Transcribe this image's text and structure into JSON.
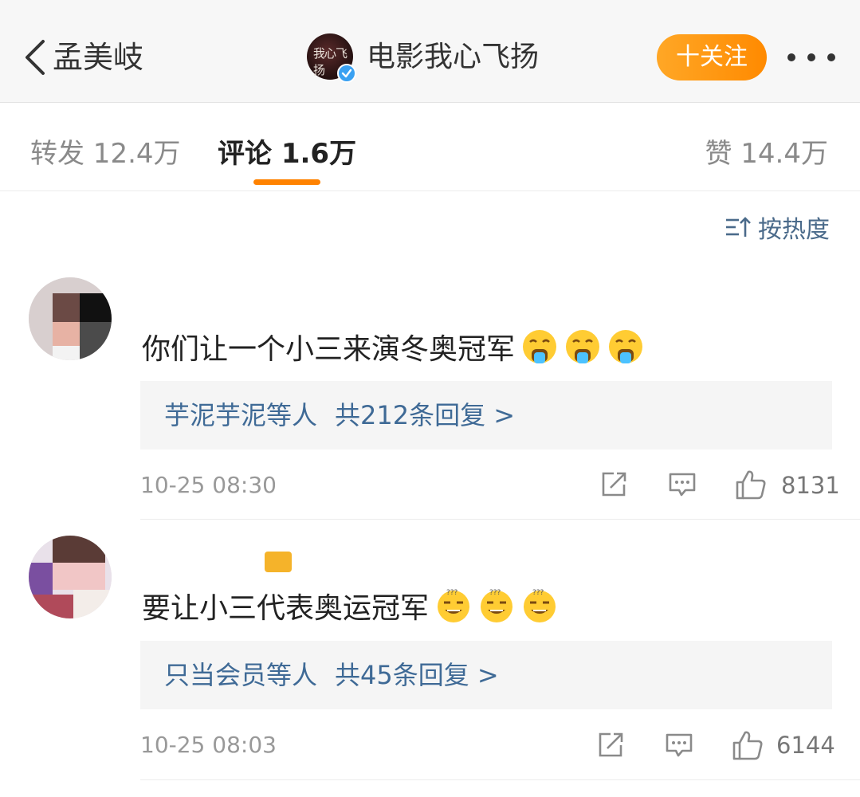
{
  "header": {
    "back_label": "孟美岐",
    "account_name": "电影我心飞扬",
    "follow_label": "十关注"
  },
  "tabs": {
    "repost": "转发 12.4万",
    "comments": "评论 1.6万",
    "likes": "赞 14.4万"
  },
  "sort": {
    "label": "按热度"
  },
  "comments": [
    {
      "text": "你们让一个小三来演冬奥冠军",
      "emojis": [
        "vomit-emoji",
        "vomit-emoji",
        "vomit-emoji"
      ],
      "replies_who": "芋泥芋泥等人",
      "replies_count": "共212条回复 >",
      "time": "10-25 08:30",
      "likes": "8131"
    },
    {
      "text": "要让小三代表奥运冠军",
      "emojis": [
        "confused-emoji",
        "confused-emoji",
        "confused-emoji"
      ],
      "replies_who": "只当会员等人",
      "replies_count": "共45条回复 >",
      "time": "10-25 08:03",
      "likes": "6144"
    }
  ],
  "colors": {
    "accent": "#ff8200",
    "link": "#3f6a96",
    "verified": "#3aa1f2"
  }
}
